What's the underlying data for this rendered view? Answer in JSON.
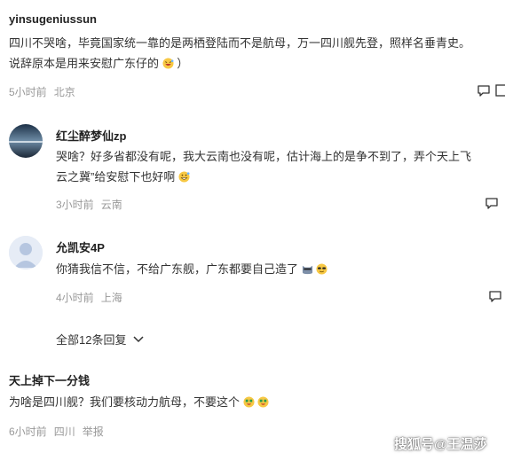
{
  "comments": [
    {
      "username": "yinsugeniussun",
      "line1": "四川不哭啥，毕竟国家统一靠的是两栖登陆而不是航母，万一四川舰先登，照样名垂青史。",
      "line2": "说辞原本是用来安慰广东仔的",
      "line2_tail": "）",
      "time": "5小时前",
      "location": "北京",
      "emojis": [
        "laughing-face-emoji"
      ]
    },
    {
      "username": "红尘醉梦仙zp",
      "line1": "哭啥？好多省都没有呢，我大云南也没有呢，估计海上的是争不到了，弄个天上飞",
      "line2": "云之冀”给安慰下也好啊",
      "time": "3小时前",
      "location": "云南",
      "emojis": [
        "grinning-sweat-emoji"
      ]
    },
    {
      "username": "允凯安4P",
      "line1": "你猜我信不信，不给广东舰，广东都要自己造了",
      "time": "4小时前",
      "location": "上海",
      "emojis": [
        "cool-cat-emoji",
        "sunglasses-emoji"
      ],
      "replies_label": "全部12条回复"
    },
    {
      "username": "天上掉下一分钱",
      "line1": "为啥是四川舰？我们要核动力航母，不要这个",
      "time": "6小时前",
      "location": "四川",
      "report": "举报",
      "emojis": [
        "money-face-emoji",
        "money-face-emoji"
      ]
    }
  ],
  "watermark": "搜狐号@王温莎",
  "colors": {
    "text": "#333333",
    "meta": "#999999",
    "username": "#222222"
  }
}
